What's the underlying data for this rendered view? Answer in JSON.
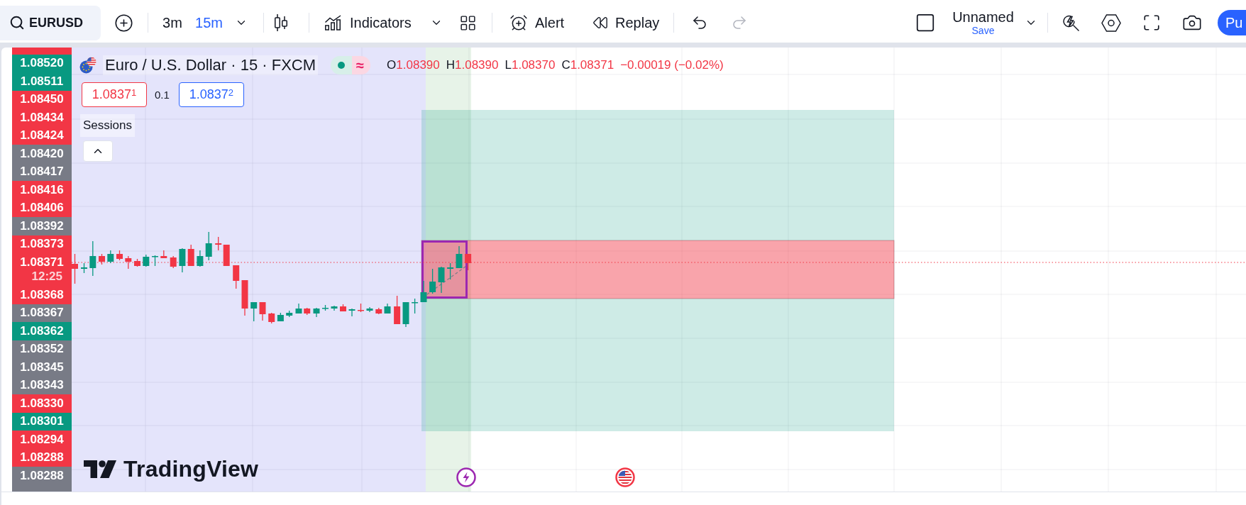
{
  "toolbar": {
    "symbol": "EURUSD",
    "intervals": [
      {
        "label": "3m",
        "selected": false
      },
      {
        "label": "15m",
        "selected": true
      }
    ],
    "indicators": "Indicators",
    "alert": "Alert",
    "replay": "Replay",
    "history": [
      {
        "kind": "undo",
        "disabled": false
      },
      {
        "kind": "redo",
        "disabled": true
      }
    ],
    "layout": {
      "name": "Unnamed",
      "action": "Save"
    },
    "publish": "Pu"
  },
  "legend": {
    "title": "Euro / U.S. Dollar · 15 · FXCM",
    "status_symbol": "≈",
    "ohlc": [
      {
        "label": "O",
        "value": "1.08390"
      },
      {
        "label": "H",
        "value": "1.08390"
      },
      {
        "label": "L",
        "value": "1.08370"
      },
      {
        "label": "C",
        "value": "1.08371"
      }
    ],
    "change": "−0.00019 (−0.02%)",
    "bid": "1.0837$^{1}$",
    "spread": "0.1",
    "ask": "1.0837$^{2}$",
    "indicator": "Sessions"
  },
  "price_axis": {
    "tags": [
      {
        "kind": "edge",
        "color": "#f23645"
      },
      {
        "kind": "price",
        "price": "1.08520",
        "color": "#089981"
      },
      {
        "kind": "price",
        "price": "1.08511",
        "color": "#089981"
      },
      {
        "kind": "price",
        "price": "1.08450",
        "color": "#f23645"
      },
      {
        "kind": "price",
        "price": "1.08434",
        "color": "#f23645"
      },
      {
        "kind": "price",
        "price": "1.08424",
        "color": "#f23645"
      },
      {
        "kind": "price",
        "price": "1.08420",
        "color": "#787b86"
      },
      {
        "kind": "price",
        "price": "1.08417",
        "color": "#787b86"
      },
      {
        "kind": "price",
        "price": "1.08416",
        "color": "#f23645"
      },
      {
        "kind": "price",
        "price": "1.08406",
        "color": "#f23645"
      },
      {
        "kind": "price",
        "price": "1.08392",
        "color": "#787b86"
      },
      {
        "kind": "price",
        "price": "1.08373",
        "color": "#f23645"
      },
      {
        "kind": "current",
        "price": "1.08371",
        "countdown": "12:25",
        "color": "#f23645"
      },
      {
        "kind": "price",
        "price": "1.08368",
        "color": "#f23645"
      },
      {
        "kind": "price",
        "price": "1.08367",
        "color": "#787b86"
      },
      {
        "kind": "price",
        "price": "1.08362",
        "color": "#089981"
      },
      {
        "kind": "price",
        "price": "1.08352",
        "color": "#787b86"
      },
      {
        "kind": "price",
        "price": "1.08345",
        "color": "#787b86"
      },
      {
        "kind": "price",
        "price": "1.08343",
        "color": "#787b86"
      },
      {
        "kind": "price",
        "price": "1.08330",
        "color": "#f23645"
      },
      {
        "kind": "price",
        "price": "1.08301",
        "color": "#089981"
      },
      {
        "kind": "price",
        "price": "1.08294",
        "color": "#f23645"
      },
      {
        "kind": "price",
        "price": "1.08288",
        "color": "#f23645"
      },
      {
        "kind": "price",
        "price": "1.08288",
        "color": "#787b86"
      },
      {
        "kind": "edge",
        "color": "#787b86"
      }
    ]
  },
  "logo": "TradingView"
}
